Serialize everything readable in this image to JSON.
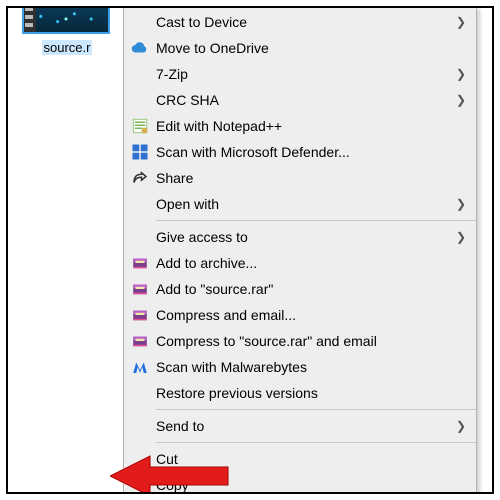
{
  "file": {
    "caption": "source.r"
  },
  "menu": {
    "items": [
      {
        "id": "cast",
        "label": "Cast to Device",
        "icon": null,
        "submenu": true
      },
      {
        "id": "onedrive",
        "label": "Move to OneDrive",
        "icon": "cloud",
        "submenu": false
      },
      {
        "id": "7zip",
        "label": "7-Zip",
        "icon": null,
        "submenu": true
      },
      {
        "id": "crcsha",
        "label": "CRC SHA",
        "icon": null,
        "submenu": true
      },
      {
        "id": "notepadpp",
        "label": "Edit with Notepad++",
        "icon": "notepadpp",
        "submenu": false
      },
      {
        "id": "defender",
        "label": "Scan with Microsoft Defender...",
        "icon": "defender",
        "submenu": false
      },
      {
        "id": "share",
        "label": "Share",
        "icon": "share",
        "submenu": false
      },
      {
        "id": "openwith",
        "label": "Open with",
        "icon": null,
        "submenu": true
      },
      {
        "sep": true
      },
      {
        "id": "giveaccess",
        "label": "Give access to",
        "icon": null,
        "submenu": true
      },
      {
        "id": "addarchive",
        "label": "Add to archive...",
        "icon": "winrar",
        "submenu": false
      },
      {
        "id": "addrar",
        "label": "Add to \"source.rar\"",
        "icon": "winrar",
        "submenu": false
      },
      {
        "id": "compemail",
        "label": "Compress and email...",
        "icon": "winrar",
        "submenu": false
      },
      {
        "id": "compraremail",
        "label": "Compress to \"source.rar\" and email",
        "icon": "winrar",
        "submenu": false
      },
      {
        "id": "malwarebytes",
        "label": "Scan with Malwarebytes",
        "icon": "malwarebytes",
        "submenu": false
      },
      {
        "id": "restore",
        "label": "Restore previous versions",
        "icon": null,
        "submenu": false
      },
      {
        "sep": true
      },
      {
        "id": "sendto",
        "label": "Send to",
        "icon": null,
        "submenu": true
      },
      {
        "sep": true
      },
      {
        "id": "cut",
        "label": "Cut",
        "icon": null,
        "submenu": false
      },
      {
        "id": "copy",
        "label": "Copy",
        "icon": null,
        "submenu": false
      }
    ]
  },
  "highlight_target": "copy"
}
